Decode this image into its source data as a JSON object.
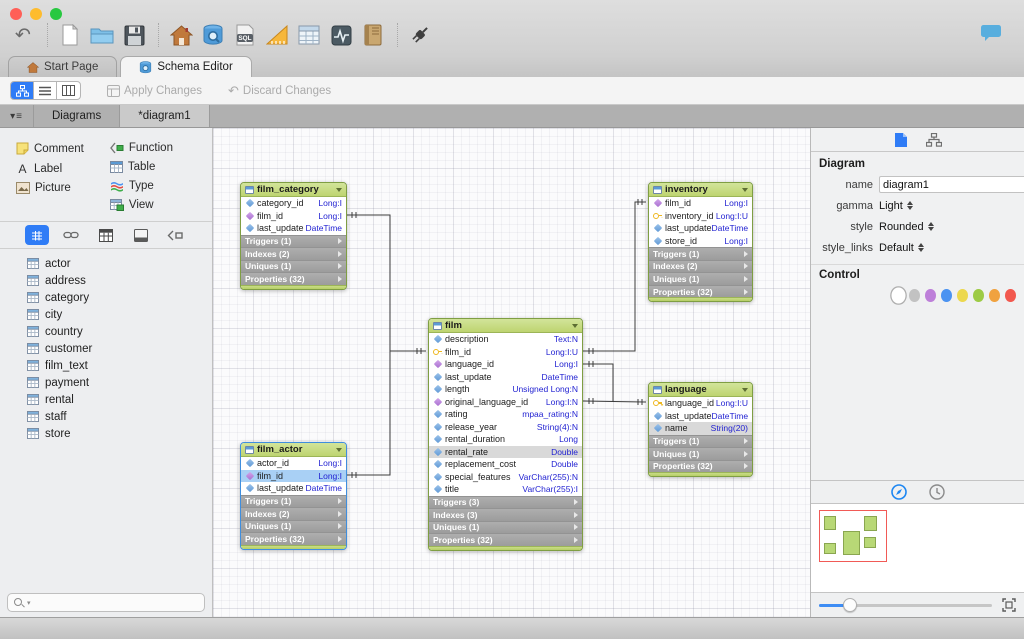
{
  "window": {
    "title": "",
    "traffic_lights": [
      "#ff5f57",
      "#febc2e",
      "#28c840"
    ]
  },
  "toolbar": {
    "icons": [
      "undo-icon",
      "new-file-icon",
      "open-folder-icon",
      "save-icon",
      "home-icon",
      "schema-icon",
      "sql-icon",
      "ruler-icon",
      "table-grid-icon",
      "monitor-icon",
      "book-icon",
      "plug-icon",
      "chat-icon"
    ]
  },
  "doc_tabs": [
    {
      "label": "Start Page",
      "icon": "home-icon",
      "active": false
    },
    {
      "label": "Schema Editor",
      "icon": "schema-icon",
      "active": true
    }
  ],
  "view_toolbar": {
    "segmented_icons": [
      "diagram-view-icon",
      "list-view-icon",
      "column-view-icon"
    ],
    "apply_label": "Apply Changes",
    "discard_label": "Discard Changes"
  },
  "diagram_bar": {
    "menu_icon": "tab-list-menu-icon",
    "tabs": [
      {
        "label": "Diagrams"
      },
      {
        "label": "*diagram1"
      }
    ]
  },
  "palette": {
    "col1": [
      {
        "label": "Comment",
        "icon": "comment-icon"
      },
      {
        "label": "Label",
        "icon": "label-icon"
      },
      {
        "label": "Picture",
        "icon": "picture-icon"
      }
    ],
    "col2": [
      {
        "label": "Function",
        "icon": "function-icon"
      },
      {
        "label": "Table",
        "icon": "table-icon"
      },
      {
        "label": "Type",
        "icon": "type-icon"
      },
      {
        "label": "View",
        "icon": "view-icon"
      }
    ]
  },
  "object_bar": {
    "icons": [
      "tables-objects-icon",
      "foreign-keys-icon",
      "views-objects-icon",
      "materialized-views-icon",
      "functions-objects-icon"
    ]
  },
  "table_list": [
    "actor",
    "address",
    "category",
    "city",
    "country",
    "customer",
    "film_text",
    "payment",
    "rental",
    "staff",
    "store"
  ],
  "search": {
    "placeholder": ""
  },
  "canvas": {
    "tables": [
      {
        "name": "film_category",
        "fields": [
          {
            "n": "category_id",
            "t": "Long:I",
            "i": "col"
          },
          {
            "n": "film_id",
            "t": "Long:I",
            "i": "fk"
          },
          {
            "n": "last_update",
            "t": "DateTime",
            "i": "col"
          }
        ],
        "sections": [
          "Triggers (1)",
          "Indexes (2)",
          "Uniques (1)",
          "Properties (32)"
        ]
      },
      {
        "name": "inventory",
        "fields": [
          {
            "n": "film_id",
            "t": "Long:I",
            "i": "fk"
          },
          {
            "n": "inventory_id",
            "t": "Long:I:U",
            "i": "pk"
          },
          {
            "n": "last_update",
            "t": "DateTime",
            "i": "col"
          },
          {
            "n": "store_id",
            "t": "Long:I",
            "i": "col"
          }
        ],
        "sections": [
          "Triggers (1)",
          "Indexes (2)",
          "Uniques (1)",
          "Properties (32)"
        ]
      },
      {
        "name": "film",
        "fields": [
          {
            "n": "description",
            "t": "Text:N",
            "i": "col"
          },
          {
            "n": "film_id",
            "t": "Long:I:U",
            "i": "pk"
          },
          {
            "n": "language_id",
            "t": "Long:I",
            "i": "fk"
          },
          {
            "n": "last_update",
            "t": "DateTime",
            "i": "col"
          },
          {
            "n": "length",
            "t": "Unsigned Long:N",
            "i": "col"
          },
          {
            "n": "original_language_id",
            "t": "Long:I:N",
            "i": "fk"
          },
          {
            "n": "rating",
            "t": "mpaa_rating:N",
            "i": "col"
          },
          {
            "n": "release_year",
            "t": "String(4):N",
            "i": "col"
          },
          {
            "n": "rental_duration",
            "t": "Long",
            "i": "col"
          },
          {
            "n": "rental_rate",
            "t": "Double",
            "i": "col",
            "hl": true
          },
          {
            "n": "replacement_cost",
            "t": "Double",
            "i": "col"
          },
          {
            "n": "special_features",
            "t": "VarChar(255):N",
            "i": "col"
          },
          {
            "n": "title",
            "t": "VarChar(255):I",
            "i": "col"
          }
        ],
        "sections": [
          "Triggers (3)",
          "Indexes (3)",
          "Uniques (1)",
          "Properties (32)"
        ]
      },
      {
        "name": "film_actor",
        "selected": true,
        "fields": [
          {
            "n": "actor_id",
            "t": "Long:I",
            "i": "col"
          },
          {
            "n": "film_id",
            "t": "Long:I",
            "i": "fk",
            "sel": true
          },
          {
            "n": "last_update",
            "t": "DateTime",
            "i": "col"
          }
        ],
        "sections": [
          "Triggers (1)",
          "Indexes (2)",
          "Uniques (1)",
          "Properties (32)"
        ]
      },
      {
        "name": "language",
        "fields": [
          {
            "n": "language_id",
            "t": "Long:I:U",
            "i": "pk"
          },
          {
            "n": "last_update",
            "t": "DateTime",
            "i": "col"
          },
          {
            "n": "name",
            "t": "String(20)",
            "i": "col",
            "hl": true
          }
        ],
        "sections": [
          "Triggers (1)",
          "Uniques (1)",
          "Properties (32)"
        ]
      }
    ],
    "links": [
      {
        "from": "film_category.film_id",
        "to": "film.film_id"
      },
      {
        "from": "film_actor.film_id",
        "to": "film.film_id"
      },
      {
        "from": "inventory.film_id",
        "to": "film.film_id"
      },
      {
        "from": "film.language_id",
        "to": "language.language_id"
      },
      {
        "from": "film.original_language_id",
        "to": "language.language_id"
      }
    ]
  },
  "inspector": {
    "tabs": [
      "properties-tab-icon",
      "structure-tab-icon"
    ],
    "section_title": "Diagram",
    "name_label": "name",
    "name_value": "diagram1",
    "gamma_label": "gamma",
    "gamma_value": "Light",
    "style_label": "style",
    "style_value": "Rounded",
    "style_links_label": "style_links",
    "style_links_value": "Default",
    "control_title": "Control",
    "control_colors": [
      "#ffffff",
      "#c2c2c2",
      "#bd7fd9",
      "#4b93f1",
      "#ecd84e",
      "#9dcb45",
      "#f0a23f",
      "#f2584e"
    ],
    "bottom_tabs": [
      "navigator-tab-icon",
      "history-tab-icon"
    ]
  }
}
